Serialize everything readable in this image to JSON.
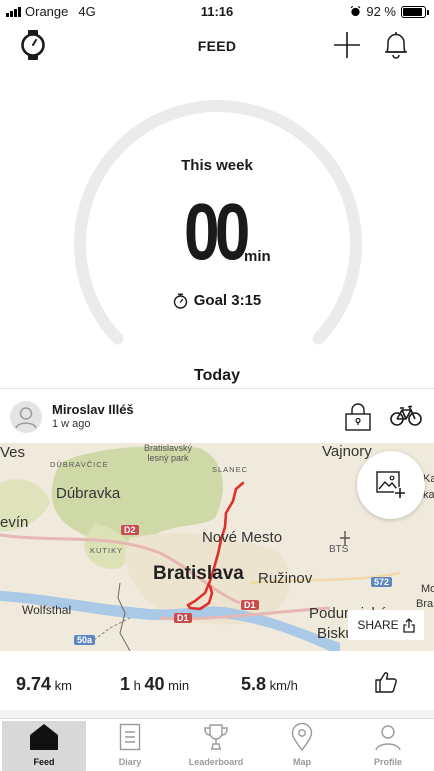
{
  "status_bar": {
    "carrier": "Orange",
    "network": "4G",
    "time": "11:16",
    "battery": "92 %"
  },
  "header": {
    "title": "FEED"
  },
  "weekly": {
    "label": "This week",
    "value": "00",
    "unit": "min",
    "goal": "Goal 3:15",
    "progress": 0
  },
  "section": {
    "today": "Today"
  },
  "workout": {
    "user_name": "Miroslav Illéš",
    "time_ago": "1 w ago",
    "activity_icon": "bike-icon",
    "map": {
      "labels": {
        "vajnory": "Vajnory",
        "dubravka": "Dúbravka",
        "nove_mesto": "Nové Mesto",
        "bratislava": "Bratislava",
        "ruzinov": "Ružinov",
        "wolfsthal": "Wolfsthal",
        "podunajske": "Podunajské",
        "biskupice": "Bisku",
        "bts": "BTS",
        "ves": "Ves",
        "devin": "evín",
        "lesny_park_1": "Bratislavský",
        "lesny_park_2": "lesný park",
        "dubravice": "DÚBRAVČICE",
        "slanec": "SLANEC",
        "kutiky": "KUTIKY",
        "edge_ka": "ka",
        "edge_kar": "Kar",
        "edge_mo": "Mo",
        "edge_bra": "Bra"
      },
      "roads": {
        "d2": "D2",
        "d1a": "D1",
        "d1b": "D1",
        "r572": "572",
        "r50a": "50a"
      }
    },
    "share_label": "SHARE",
    "stats": {
      "distance_value": "9.74",
      "distance_unit": "km",
      "duration_h": "1",
      "duration_h_unit": "h",
      "duration_m": "40",
      "duration_m_unit": "min",
      "speed_value": "5.8",
      "speed_unit": "km/h"
    }
  },
  "nav": {
    "items": [
      {
        "label": "Feed",
        "icon": "home-icon",
        "active": true
      },
      {
        "label": "Diary",
        "icon": "diary-icon"
      },
      {
        "label": "Leaderboard",
        "icon": "trophy-icon"
      },
      {
        "label": "Map",
        "icon": "map-pin-icon"
      },
      {
        "label": "Profile",
        "icon": "profile-icon"
      }
    ]
  },
  "colors": {
    "accent": "#1a1a1a",
    "ring_track": "#ebebeb",
    "route": "#e0302c",
    "nav_active_bg": "#d9d9d9"
  }
}
